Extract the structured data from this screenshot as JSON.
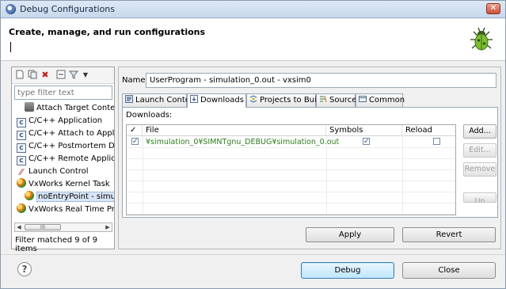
{
  "window": {
    "title": "Debug Configurations",
    "close_glyph": "✕"
  },
  "header": {
    "title": "Create, manage, and run configurations",
    "icon": "bug-icon"
  },
  "left": {
    "toolbar_icons": [
      "new-config-icon",
      "duplicate-icon",
      "delete-icon",
      "collapse-icon",
      "filter-icon",
      "dropdown-icon"
    ],
    "filter_placeholder": "type filter text",
    "tree": [
      {
        "label": "Attach Target Context",
        "icon": "attach-target-icon",
        "indent": 0
      },
      {
        "label": "C/C++ Application",
        "icon": "c-app-icon",
        "indent": 0
      },
      {
        "label": "C/C++ Attach to Application",
        "icon": "c-app-icon",
        "indent": 0
      },
      {
        "label": "C/C++ Postmortem Debugger",
        "icon": "c-app-icon",
        "indent": 0
      },
      {
        "label": "C/C++ Remote Application",
        "icon": "c-app-icon",
        "indent": 0
      },
      {
        "label": "Launch Control",
        "icon": "launch-control-icon",
        "indent": 0
      },
      {
        "label": "VxWorks Kernel Task",
        "icon": "vxworks-icon",
        "indent": 0
      },
      {
        "label": "noEntryPoint - simulation",
        "icon": "vxworks-icon",
        "indent": 1,
        "selected": true
      },
      {
        "label": "VxWorks Real Time Process",
        "icon": "vxworks-icon",
        "indent": 0
      }
    ],
    "scroll_thumb_glyph": "III",
    "status": "Filter matched 9 of 9 items"
  },
  "right": {
    "name_label": "Name:",
    "name_value": "UserProgram - simulation_0.out - vxsim0",
    "tabs": [
      {
        "label": "Launch Context",
        "icon": "launch-context-icon"
      },
      {
        "label": "Downloads",
        "icon": "downloads-icon",
        "active": true
      },
      {
        "label": "Projects to Build",
        "icon": "projects-icon"
      },
      {
        "label": "Source",
        "icon": "source-icon"
      },
      {
        "label": "Common",
        "icon": "common-icon"
      }
    ],
    "downloads_label": "Downloads:",
    "table": {
      "columns": [
        "✓",
        "File",
        "Symbols",
        "Reload"
      ],
      "rows": [
        {
          "checked": true,
          "file": "¥simulation_0¥SIMNTgnu_DEBUG¥simulation_0.out",
          "symbols": true,
          "reload": false
        }
      ]
    },
    "side_buttons": [
      {
        "label": "Add...",
        "enabled": true
      },
      {
        "label": "Edit...",
        "enabled": false
      },
      {
        "label": "Remove",
        "enabled": false
      },
      {
        "label": "Up",
        "enabled": false
      }
    ],
    "apply_label": "Apply",
    "revert_label": "Revert"
  },
  "footer": {
    "help_glyph": "?",
    "debug_label": "Debug",
    "close_label": "Close"
  }
}
